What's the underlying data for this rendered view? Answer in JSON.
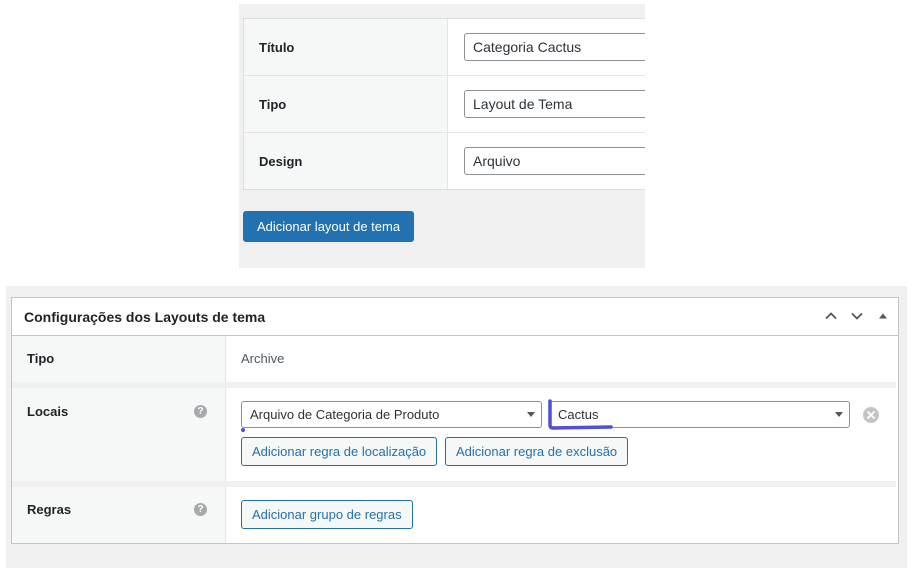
{
  "form": {
    "rows": [
      {
        "label": "Título",
        "value": "Categoria Cactus"
      },
      {
        "label": "Tipo",
        "value": "Layout de Tema"
      },
      {
        "label": "Design",
        "value": "Arquivo"
      }
    ],
    "submit_label": "Adicionar layout de tema"
  },
  "settings": {
    "title": "Configurações dos Layouts de tema",
    "tipo": {
      "label": "Tipo",
      "value": "Archive"
    },
    "locais": {
      "label": "Locais",
      "location_select": "Arquivo de Categoria de Produto",
      "term_select": "Cactus",
      "add_location_label": "Adicionar regra de localização",
      "add_exclusion_label": "Adicionar regra de exclusão"
    },
    "regras": {
      "label": "Regras",
      "add_group_label": "Adicionar grupo de regras"
    },
    "help_glyph": "?",
    "icons": {
      "move_up": "chevron-up-icon",
      "move_down": "chevron-down-icon",
      "toggle": "triangle-up-icon",
      "remove": "close-circle-icon",
      "help": "help-icon"
    }
  },
  "colors": {
    "primary": "#2271b1",
    "highlight": "#4f4fd9"
  }
}
